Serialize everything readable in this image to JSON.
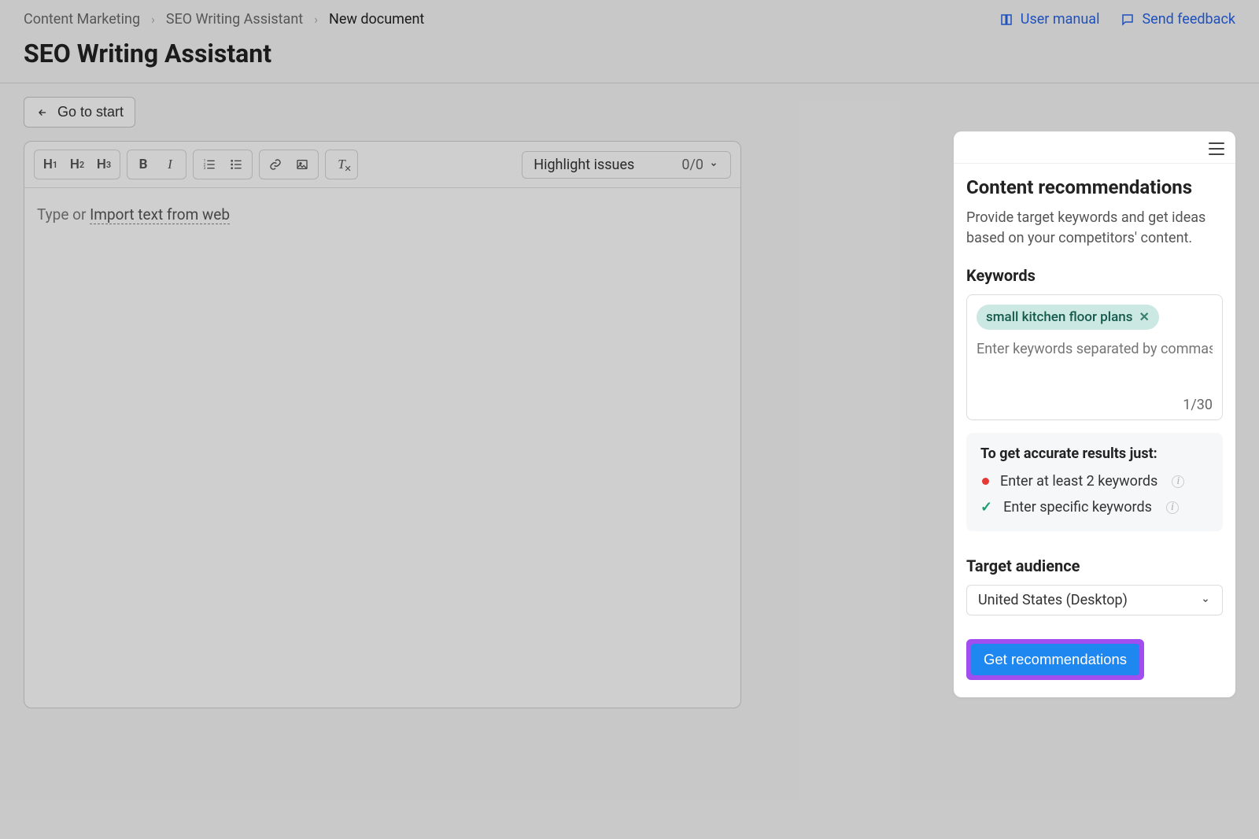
{
  "breadcrumbs": {
    "level1": "Content Marketing",
    "level2": "SEO Writing Assistant",
    "current": "New document"
  },
  "header": {
    "user_manual": "User manual",
    "send_feedback": "Send feedback",
    "title": "SEO Writing Assistant"
  },
  "buttons": {
    "go_to_start": "Go to start"
  },
  "toolbar": {
    "highlight_label": "Highlight issues",
    "highlight_count": "0/0"
  },
  "editor": {
    "placeholder_prefix": "Type or ",
    "import_link": "Import text from web"
  },
  "panel": {
    "title": "Content recommendations",
    "description": "Provide target keywords and get ideas based on your competitors' content.",
    "keywords_label": "Keywords",
    "keyword_chip": "small kitchen floor plans",
    "keywords_placeholder": "Enter keywords separated by commas",
    "keywords_count": "1/30",
    "tips_title": "To get accurate results just:",
    "tip1": "Enter at least 2 keywords",
    "tip2": "Enter specific keywords",
    "audience_label": "Target audience",
    "audience_value": "United States (Desktop)",
    "get_recs": "Get recommendations"
  }
}
